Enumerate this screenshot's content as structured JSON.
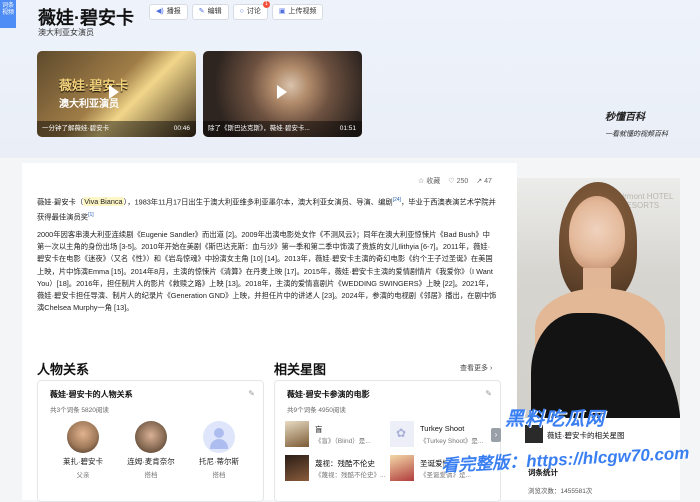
{
  "left_tab": {
    "label": "词条\n视频"
  },
  "header": {
    "title": "薇娃·碧安卡",
    "subtitle": "澳大利亚女演员",
    "tools": [
      {
        "icon": "speaker-icon",
        "label": "播报"
      },
      {
        "icon": "edit-icon",
        "label": "编辑"
      },
      {
        "icon": "comment-icon",
        "label": "讨论",
        "badge": "1"
      },
      {
        "icon": "upload-icon",
        "label": "上传视频"
      }
    ]
  },
  "videos": [
    {
      "overlay_line1": "薇娃·碧安卡",
      "overlay_line2": "澳大利亚演员",
      "caption": "一分钟了解薇娃·碧安卡",
      "duration": "00:46"
    },
    {
      "caption": "除了《斯巴达克斯》，薇娃·碧安卡...",
      "duration": "01:51"
    }
  ],
  "brand": {
    "logo": "秒懂百科",
    "slogan": "一看就懂的视频百科"
  },
  "stats": {
    "collect_label": "收藏",
    "likes": "250",
    "shares": "47"
  },
  "intro": {
    "name": "薇娃·碧安卡",
    "original": "Viva Bianca",
    "text_a": "，1983年11月17日出生于澳大利亚维多利亚墨尔本，澳大利亚女演员、导演、编剧",
    "ref_a": "[24]",
    "text_b": "，毕业于西澳表演艺术学院并获得最佳演员奖",
    "ref_b": "[1]"
  },
  "career": {
    "text": "2000年因客串澳大利亚连续剧《Eugenie Sandler》而出道 [2]。2009年出演电影处女作《不测风云》；同年在澳大利亚惊悚片《Bad Bush》中第一次以主角的身份出场 [3-5]。2010年开始在美剧《斯巴达克斯：血与沙》第一季和第二季中饰演了贵族的女儿Ilithyia [6-7]。2011年，薇娃·碧安卡在电影《迷夜》（又名《性》）和《岩岛惊魂》中扮演女主角 [10] [14]。2013年，薇娃·碧安卡主演的奇幻电影《约个王子过圣诞》在美国上映，片中饰演Emma [15]。2014年8月，主演的惊悚片《清算》在丹麦上映 [17]。2015年，薇娃·碧安卡主演的爱情剧情片《我爱你》（I Want You）[18]。2016年，担任制片人的影片《救赎之路》上映 [13]。2018年，主演的爱情喜剧片《WEDDING SWINGERS》上映 [22]。2021年，薇娃·碧安卡担任导演、制片人的纪录片《Generation GND》上映，并担任片中的讲述人 [23]。2024年，参演的电视剧《邻居》播出，在剧中饰演Chelsea Murphy一角 [13]。"
  },
  "relations": {
    "section_title": "人物关系",
    "card_title": "薇娃·碧安卡的人物关系",
    "meta": "共3个词条  5820阅读",
    "people": [
      {
        "name": "莱扎·碧安卡",
        "role": "父亲",
        "color": "#a07a5a"
      },
      {
        "name": "连姆·麦肯奈尔",
        "role": "搭档",
        "color": "#8a6d55"
      },
      {
        "name": "托尼·蒂尔斯",
        "role": "搭档",
        "color": "#cfd8f5"
      }
    ]
  },
  "stars": {
    "section_title": "相关星图",
    "more_label": "查看更多",
    "card_title": "薇娃·碧安卡参演的电影",
    "meta": "共9个词条  4950阅读",
    "movies": [
      {
        "title": "盲",
        "desc": "《盲》（Blind）是...",
        "color": "#7c5a34"
      },
      {
        "title": "Turkey Shoot",
        "desc": "《Turkey Shoot》是...",
        "color": "#c9cbe6"
      },
      {
        "title": "蔑视：残酷不伦史",
        "desc": "《蔑视：残酷不伦史》...",
        "color": "#5a3c2c"
      },
      {
        "title": "圣诞爱情",
        "desc": "《圣诞爱情》是...",
        "color": "#b03c3c"
      }
    ]
  },
  "side": {
    "star_title": "薇娃·碧安卡的相关星图",
    "stats_title": "词条统计",
    "views_label": "浏览次数：",
    "views": "1455581次"
  },
  "photo": {
    "backdrop": "Fairmont HOTEL & RESORTS"
  },
  "watermark": {
    "line1": "黑料吃瓜网",
    "line2": "看完整版：https://hlcgw70.com"
  }
}
